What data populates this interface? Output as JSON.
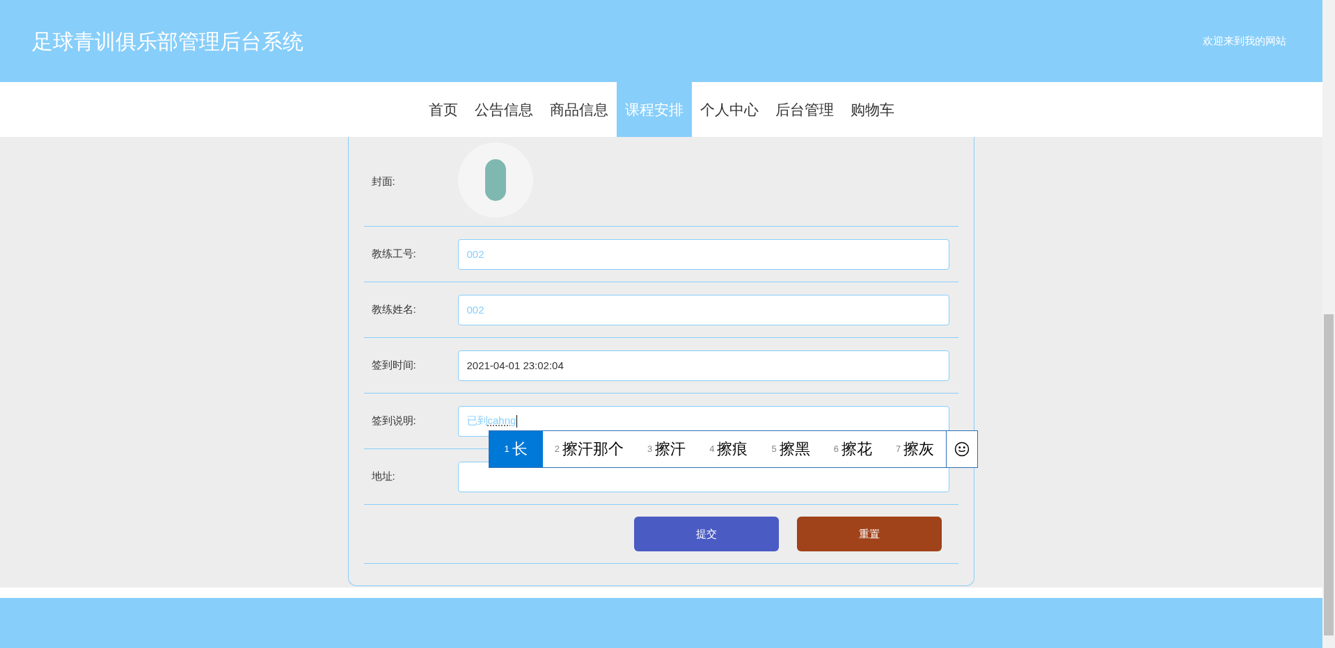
{
  "header": {
    "title": "足球青训俱乐部管理后台系统",
    "welcome": "欢迎来到我的网站"
  },
  "nav": [
    {
      "label": "首页",
      "selected": false
    },
    {
      "label": "公告信息",
      "selected": false
    },
    {
      "label": "商品信息",
      "selected": false
    },
    {
      "label": "课程安排",
      "selected": true
    },
    {
      "label": "个人中心",
      "selected": false
    },
    {
      "label": "后台管理",
      "selected": false
    },
    {
      "label": "购物车",
      "selected": false
    }
  ],
  "form": {
    "cover": {
      "label": "封面:"
    },
    "fields": [
      {
        "label": "教练工号:",
        "value": "002",
        "kind": "readonly"
      },
      {
        "label": "教练姓名:",
        "value": "002",
        "kind": "readonly"
      },
      {
        "label": "签到时间:",
        "value": "2021-04-01 23:02:04",
        "kind": "text"
      },
      {
        "label": "签到说明:",
        "value": "已到",
        "composition": "cahng",
        "kind": "composing",
        "ime": {
          "candidates": [
            {
              "number": "1",
              "text": "长",
              "selected": true
            },
            {
              "number": "2",
              "text": "擦汗那个",
              "selected": false
            },
            {
              "number": "3",
              "text": "擦汗",
              "selected": false
            },
            {
              "number": "4",
              "text": "擦痕",
              "selected": false
            },
            {
              "number": "5",
              "text": "擦黑",
              "selected": false
            },
            {
              "number": "6",
              "text": "擦花",
              "selected": false
            },
            {
              "number": "7",
              "text": "擦灰",
              "selected": false
            }
          ]
        }
      },
      {
        "label": "地址:",
        "kind": "text"
      }
    ],
    "buttons": [
      {
        "label": "提交",
        "kind": "submit"
      },
      {
        "label": "重置",
        "kind": "reset"
      }
    ]
  }
}
